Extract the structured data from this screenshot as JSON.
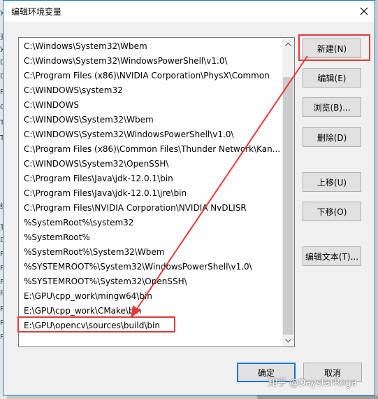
{
  "background_window": {
    "left_edge_text": [
      "y",
      "变",
      "y",
      "D",
      "D",
      "P",
      "Q",
      "TE",
      "TI",
      "统",
      "变",
      "D",
      "P",
      "P",
      "F",
      "R",
      "P",
      "P",
      "P"
    ]
  },
  "dialog": {
    "title": "编辑环境变量",
    "close_icon": "close-icon"
  },
  "path_list": {
    "items": [
      "C:\\Windows\\System32\\Wbem",
      "C:\\Windows\\System32\\WindowsPowerShell\\v1.0\\",
      "C:\\Program Files (x86)\\NVIDIA Corporation\\PhysX\\Common",
      "C:\\WINDOWS\\system32",
      "C:\\WINDOWS",
      "C:\\WINDOWS\\System32\\Wbem",
      "C:\\WINDOWS\\System32\\WindowsPowerShell\\v1.0\\",
      "C:\\Program Files (x86)\\Common Files\\Thunder Network\\Kan...",
      "C:\\WINDOWS\\System32\\OpenSSH\\",
      "C:\\Program Files\\Java\\jdk-12.0.1\\bin",
      "C:\\Program Files\\Java\\jdk-12.0.1\\jre\\bin",
      "C:\\Program Files\\NVIDIA Corporation\\NVIDIA NvDLISR",
      "%SystemRoot%\\system32",
      "%SystemRoot%",
      "%SystemRoot%\\System32\\Wbem",
      "%SYSTEMROOT%\\System32\\WindowsPowerShell\\v1.0\\",
      "%SYSTEMROOT%\\System32\\OpenSSH\\",
      "E:\\GPU\\cpp_work\\mingw64\\bin",
      "E:\\GPU\\cpp_work\\CMake\\bin",
      "E:\\GPU\\opencv\\sources\\build\\bin"
    ],
    "scroll_up_icon": "chevron-up-icon",
    "scroll_down_icon": "chevron-down-icon"
  },
  "buttons": {
    "new": "新建(N)",
    "edit": "编辑(E)",
    "browse": "浏览(B)...",
    "delete": "删除(D)",
    "move_up": "上移(U)",
    "move_down": "下移(O)",
    "edit_text": "编辑文本(T)...",
    "ok": "确定",
    "cancel": "取消"
  },
  "annotations": {
    "highlight_color": "#e53935"
  },
  "watermark": "知乎 @DaystarRoga",
  "colors": {
    "accent": "#0078d7",
    "dialog_border": "#1979ca"
  }
}
